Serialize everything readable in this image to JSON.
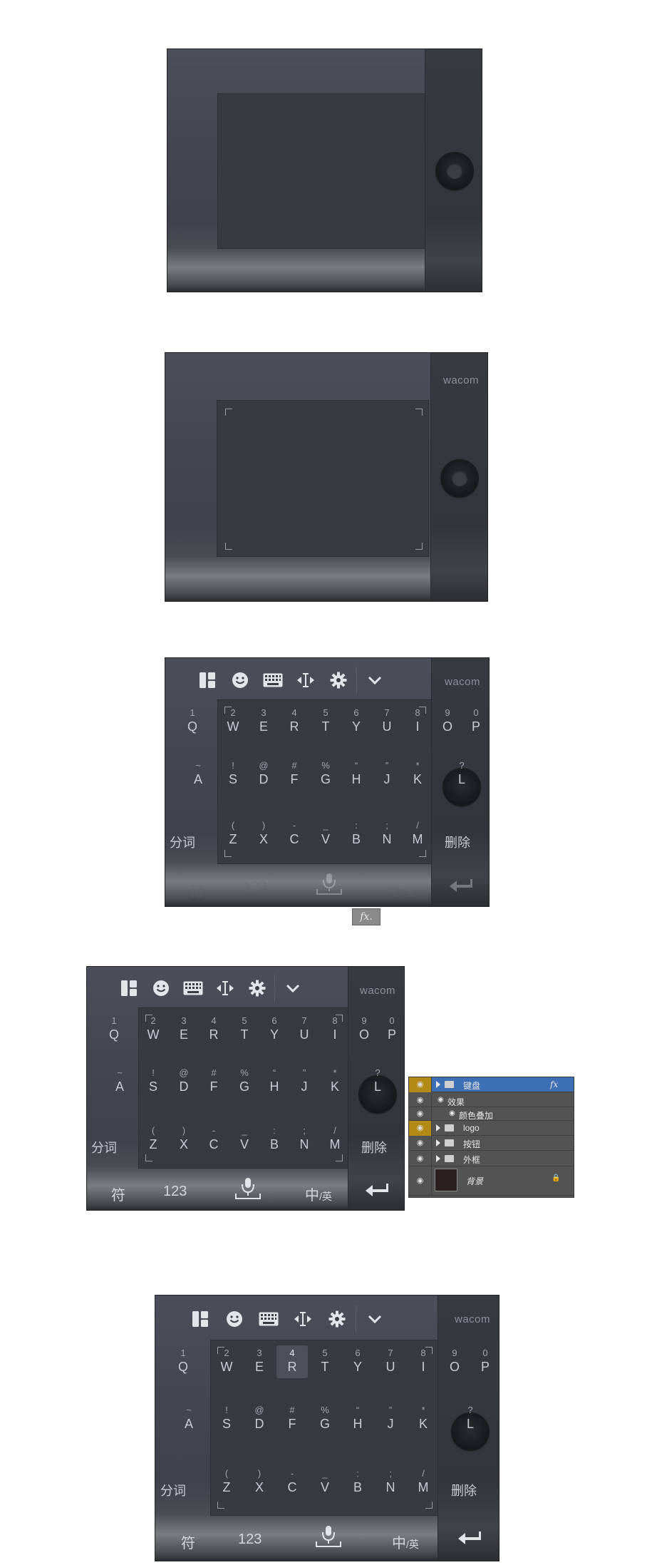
{
  "brand": "wacom",
  "toolbar_icons": [
    "layout-icon",
    "emoji-icon",
    "keyboard-icon",
    "cursor-move-icon",
    "gear-icon",
    "chevron-down-icon"
  ],
  "keyboard": {
    "row1": [
      {
        "n": "1",
        "l": "Q"
      },
      {
        "n": "2",
        "l": "W"
      },
      {
        "n": "3",
        "l": "E"
      },
      {
        "n": "4",
        "l": "R"
      },
      {
        "n": "5",
        "l": "T"
      },
      {
        "n": "6",
        "l": "Y"
      },
      {
        "n": "7",
        "l": "U"
      },
      {
        "n": "8",
        "l": "I"
      },
      {
        "n": "9",
        "l": "O"
      },
      {
        "n": "0",
        "l": "P"
      }
    ],
    "row2": [
      {
        "n": "~",
        "l": "A"
      },
      {
        "n": "!",
        "l": "S"
      },
      {
        "n": "@",
        "l": "D"
      },
      {
        "n": "#",
        "l": "F"
      },
      {
        "n": "%",
        "l": "G"
      },
      {
        "n": "“",
        "l": "H"
      },
      {
        "n": "”",
        "l": "J"
      },
      {
        "n": "*",
        "l": "K"
      },
      {
        "n": "?",
        "l": "L"
      }
    ],
    "row3": [
      {
        "n": "(",
        "l": "Z"
      },
      {
        "n": ")",
        "l": "X"
      },
      {
        "n": "-",
        "l": "C"
      },
      {
        "n": "_",
        "l": "V"
      },
      {
        "n": ":",
        "l": "B"
      },
      {
        "n": ";",
        "l": "N"
      },
      {
        "n": "/",
        "l": "M"
      }
    ],
    "split_label": "分词",
    "delete_label": "删除",
    "symbol_label": "符",
    "numeric_label": "123",
    "lang_label_zh": "中",
    "lang_label_en": "/英"
  },
  "fx_button": "fx.",
  "layers_panel": {
    "rows": [
      {
        "name": "键盘",
        "fx": "fx",
        "selected": true,
        "gold": true,
        "folder": true
      },
      {
        "name": "效果",
        "sub": 1
      },
      {
        "name": "颜色叠加",
        "sub": 2
      },
      {
        "name": "logo",
        "gold": true,
        "folder": true
      },
      {
        "name": "按钮",
        "folder": true
      },
      {
        "name": "外框",
        "folder": true
      },
      {
        "name": "背景",
        "background": true
      }
    ]
  }
}
